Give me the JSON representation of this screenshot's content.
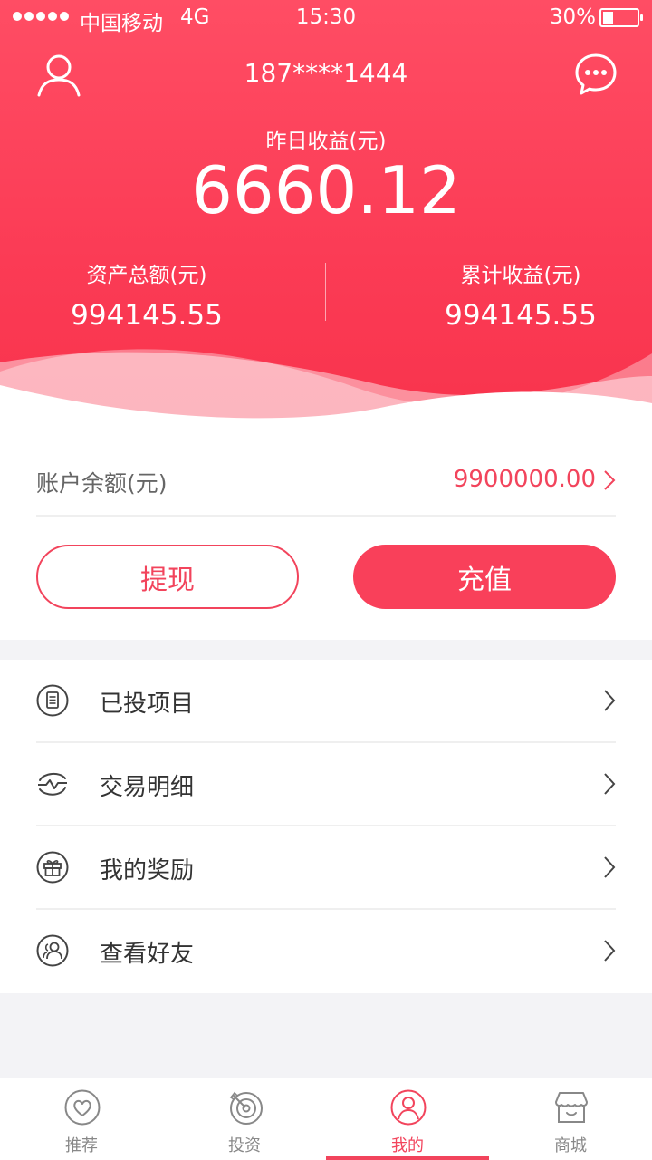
{
  "status_bar": {
    "carrier": "中国移动",
    "network": "4G",
    "time": "15:30",
    "battery": "30%",
    "battery_level": 0.3
  },
  "header": {
    "phone": "187****1444",
    "yesterday_label": "昨日收益(元)",
    "yesterday_value": "6660.12",
    "total_assets_label": "资产总额(元)",
    "total_assets_value": "994145.55",
    "cumulative_label": "累计收益(元)",
    "cumulative_value": "994145.55"
  },
  "balance": {
    "label": "账户余额(元)",
    "amount": "9900000.00"
  },
  "actions": {
    "withdraw": "提现",
    "recharge": "充值"
  },
  "menu": [
    {
      "label": "已投项目",
      "icon": "document-icon"
    },
    {
      "label": "交易明细",
      "icon": "wave-transaction-icon"
    },
    {
      "label": "我的奖励",
      "icon": "gift-icon"
    },
    {
      "label": "查看好友",
      "icon": "friends-icon"
    }
  ],
  "tabs": [
    {
      "label": "推荐",
      "icon": "heart-icon"
    },
    {
      "label": "投资",
      "icon": "target-icon"
    },
    {
      "label": "我的",
      "icon": "profile-icon",
      "active": true
    },
    {
      "label": "商城",
      "icon": "store-icon"
    }
  ],
  "colors": {
    "accent": "#f2445c",
    "header_top": "#ff4d64",
    "header_bottom": "#f8334c"
  }
}
